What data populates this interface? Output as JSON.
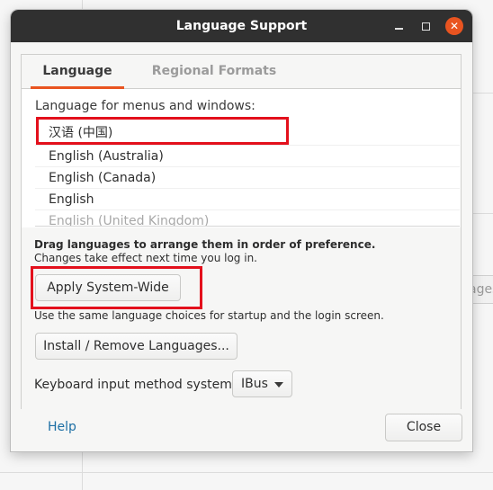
{
  "window": {
    "title": "Language Support"
  },
  "tabs": [
    {
      "label": "Language",
      "active": true
    },
    {
      "label": "Regional Formats",
      "active": false
    }
  ],
  "language_section": {
    "heading": "Language for menus and windows:",
    "languages": [
      "汉语 (中国)",
      "English (Australia)",
      "English (Canada)",
      "English",
      "English (United Kingdom)"
    ],
    "hint_bold": "Drag languages to arrange them in order of preference.",
    "hint": "Changes take effect next time you log in.",
    "apply_button": "Apply System-Wide",
    "apply_note": "Use the same language choices for startup and the login screen.",
    "install_button": "Install / Remove Languages...",
    "keyboard_label": "Keyboard input method system:",
    "keyboard_value": "IBus"
  },
  "footer": {
    "help_label": "Help",
    "close_label": "Close"
  },
  "background": {
    "peek_text": "ages"
  },
  "colors": {
    "titlebar": "#303030",
    "accent": "#e95420",
    "link": "#1c6ea4",
    "annotation": "#e3101c"
  }
}
